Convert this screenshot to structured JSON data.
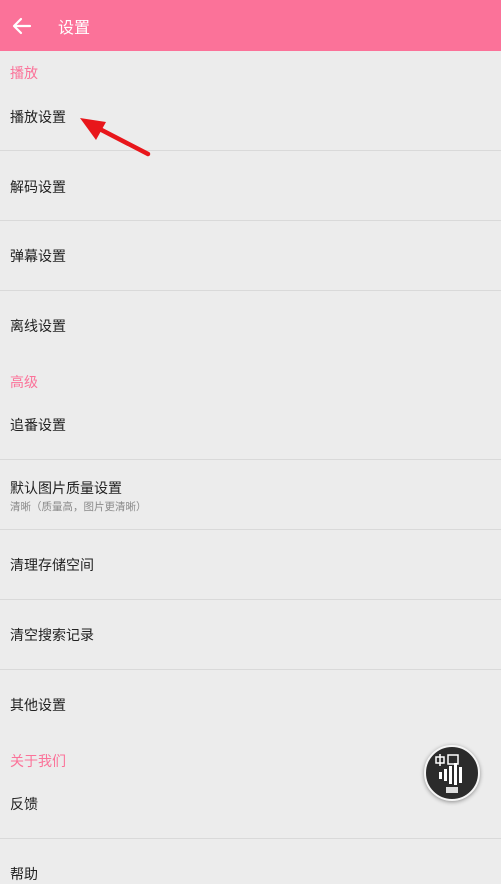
{
  "appbar": {
    "title": "设置"
  },
  "sections": {
    "play": {
      "header": "播放"
    },
    "advanced": {
      "header": "高级"
    },
    "about": {
      "header": "关于我们"
    }
  },
  "rows": {
    "play_settings": "播放设置",
    "decode_settings": "解码设置",
    "danmaku_settings": "弹幕设置",
    "offline_settings": "离线设置",
    "follow_settings": "追番设置",
    "image_quality": {
      "label": "默认图片质量设置",
      "sub": "清晰（质量高，图片更清晰）"
    },
    "clear_storage": "清理存储空间",
    "clear_search": "清空搜索记录",
    "other_settings": "其他设置",
    "feedback": "反馈",
    "help": "帮助"
  },
  "colors": {
    "accent": "#fb7299",
    "background": "#ececec",
    "annotation": "#e8161b"
  },
  "icons": {
    "back": "arrow-left-icon",
    "fab": "watermark-badge-icon",
    "annotation": "red-pointer-arrow"
  }
}
